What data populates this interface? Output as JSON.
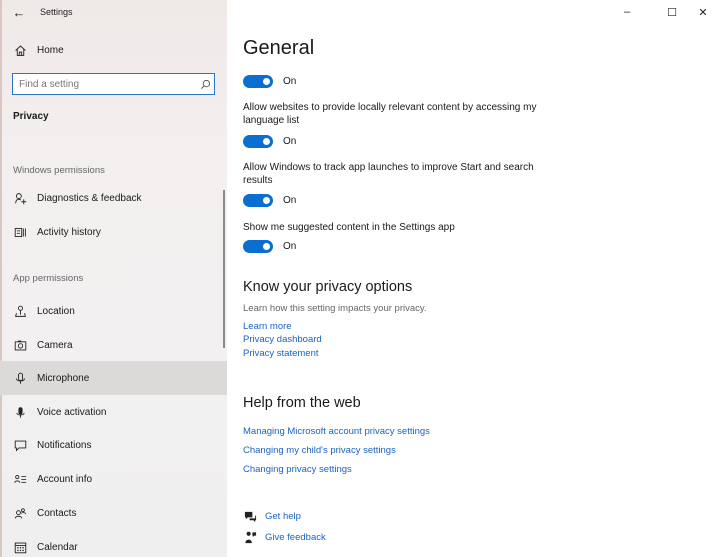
{
  "window": {
    "title": "Settings",
    "controls": {
      "minimize": "–",
      "maximize": "☐",
      "close": "✕"
    },
    "back_glyph": "←"
  },
  "sidebar": {
    "home_label": "Home",
    "search": {
      "placeholder": "Find a setting",
      "value": ""
    },
    "current_section": "Privacy",
    "groups": [
      {
        "label": "Windows permissions",
        "items": [
          {
            "label": "Diagnostics & feedback",
            "icon": "diagnostics-icon"
          },
          {
            "label": "Activity history",
            "icon": "activity-history-icon"
          }
        ]
      },
      {
        "label": "App permissions",
        "items": [
          {
            "label": "Location",
            "icon": "location-icon"
          },
          {
            "label": "Camera",
            "icon": "camera-icon"
          },
          {
            "label": "Microphone",
            "icon": "microphone-icon",
            "selected": true
          },
          {
            "label": "Voice activation",
            "icon": "voice-activation-icon"
          },
          {
            "label": "Notifications",
            "icon": "notifications-icon"
          },
          {
            "label": "Account info",
            "icon": "account-info-icon"
          },
          {
            "label": "Contacts",
            "icon": "contacts-icon"
          },
          {
            "label": "Calendar",
            "icon": "calendar-icon"
          }
        ]
      }
    ]
  },
  "main": {
    "title": "General",
    "settings": [
      {
        "description": "",
        "state": "On",
        "on": true
      },
      {
        "description": "Allow websites to provide locally relevant content by accessing my language list",
        "state": "On",
        "on": true
      },
      {
        "description": "Allow Windows to track app launches to improve Start and search results",
        "state": "On",
        "on": true
      },
      {
        "description": "Show me suggested content in the Settings app",
        "state": "On",
        "on": true
      }
    ],
    "privacy_options": {
      "heading": "Know your privacy options",
      "subtext": "Learn how this setting impacts your privacy.",
      "links": [
        "Learn more",
        "Privacy dashboard",
        "Privacy statement"
      ]
    },
    "help": {
      "heading": "Help from the web",
      "links": [
        "Managing Microsoft account privacy settings",
        "Changing my child's privacy settings",
        "Changing privacy settings"
      ]
    },
    "support": [
      {
        "label": "Get help",
        "icon": "get-help-icon"
      },
      {
        "label": "Give feedback",
        "icon": "give-feedback-icon"
      }
    ]
  },
  "colors": {
    "accent": "#0a6fd1",
    "link": "#1a62c6",
    "selected_bg": "#dcdad9"
  }
}
